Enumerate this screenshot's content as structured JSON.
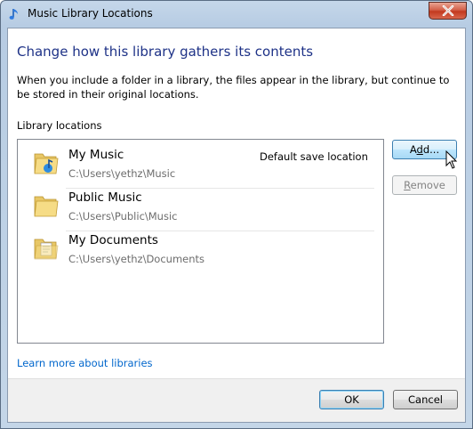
{
  "window": {
    "title": "Music Library Locations",
    "close_label": "Close"
  },
  "content": {
    "heading": "Change how this library gathers its contents",
    "description": "When you include a folder in a library, the files appear in the library, but continue to be stored in their original locations.",
    "locations_label": "Library locations",
    "learn_more_link": "Learn more about libraries"
  },
  "locations": [
    {
      "name": "My Music",
      "path": "C:\\Users\\yethz\\Music",
      "badge": "Default save location",
      "icon": "music-folder-icon"
    },
    {
      "name": "Public Music",
      "path": "C:\\Users\\Public\\Music",
      "badge": "",
      "icon": "folder-icon"
    },
    {
      "name": "My Documents",
      "path": "C:\\Users\\yethz\\Documents",
      "badge": "",
      "icon": "documents-folder-icon"
    }
  ],
  "buttons": {
    "add_prefix": "A",
    "add_underline": "d",
    "add_suffix": "d...",
    "remove_underline": "R",
    "remove_suffix": "emove",
    "ok": "OK",
    "cancel": "Cancel"
  },
  "colors": {
    "heading": "#1e3287",
    "link": "#0066cc",
    "accent_button": "#3c7fb1"
  }
}
